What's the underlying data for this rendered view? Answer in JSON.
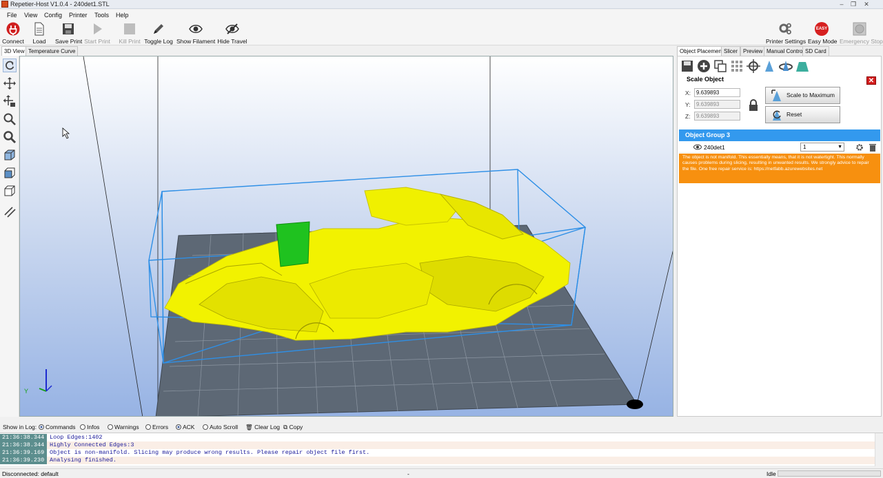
{
  "window": {
    "title": "Repetier-Host V1.0.4 - 240det1.STL",
    "min": "‒",
    "max": "❐",
    "close": "✕"
  },
  "menu": [
    "File",
    "View",
    "Config",
    "Printer",
    "Tools",
    "Help"
  ],
  "toolbar": {
    "connect": "Connect",
    "load": "Load",
    "save_print": "Save Print",
    "start_print": "Start Print",
    "kill_print": "Kill Print",
    "toggle_log": "Toggle Log",
    "show_filament": "Show Filament",
    "hide_travel": "Hide Travel",
    "printer_settings": "Printer Settings",
    "easy_mode": "Easy Mode",
    "emergency_stop": "Emergency Stop",
    "easy_badge": "EASY"
  },
  "view_tabs": [
    "3D View",
    "Temperature Curve"
  ],
  "panel_tabs": [
    "Object Placement",
    "Slicer",
    "Preview",
    "Manual Control",
    "SD Card"
  ],
  "scale": {
    "title": "Scale Object",
    "x_label": "X:",
    "y_label": "Y:",
    "z_label": "Z:",
    "x": "9.639893",
    "y": "9.639893",
    "z": "9.639893",
    "scale_max": "Scale to Maximum",
    "reset": "Reset",
    "close": "✕"
  },
  "objects": {
    "group": "Object Group 3",
    "items": [
      {
        "name": "240det1",
        "copies": "1"
      }
    ],
    "warning": "The object is not manifold. This essentially means, that it is not watertight. This normally causes problems during slicing, resulting in unwanted results. We strongly advice to repair the file. One free repair service is: https://netfabb.azurewebsites.net"
  },
  "log": {
    "show_in_log": "Show in Log:",
    "options": [
      {
        "label": "Commands",
        "on": true
      },
      {
        "label": "Infos",
        "on": false
      },
      {
        "label": "Warnings",
        "on": false
      },
      {
        "label": "Errors",
        "on": false
      },
      {
        "label": "ACK",
        "on": true
      },
      {
        "label": "Auto Scroll",
        "on": false
      }
    ],
    "clear": "Clear Log",
    "copy": "Copy",
    "entries": [
      {
        "time": "21:36:38.344",
        "msg": "Loop Edges:1402"
      },
      {
        "time": "21:36:38.344",
        "msg": "Highly Connected Edges:3"
      },
      {
        "time": "21:36:39.169",
        "msg": "Object is non-manifold. Slicing may produce wrong results. Please repair object file first."
      },
      {
        "time": "21:36:39.230",
        "msg": "Analysing finished."
      }
    ]
  },
  "status": {
    "left": "Disconnected: default",
    "mid": "-",
    "right": "Idle"
  },
  "axis_label": "Y",
  "colors": {
    "model": "#f2f200",
    "selection_box": "#2e8fe6",
    "bed": "#5d6875",
    "accent": "#3399ee",
    "warning": "#f7900f"
  }
}
